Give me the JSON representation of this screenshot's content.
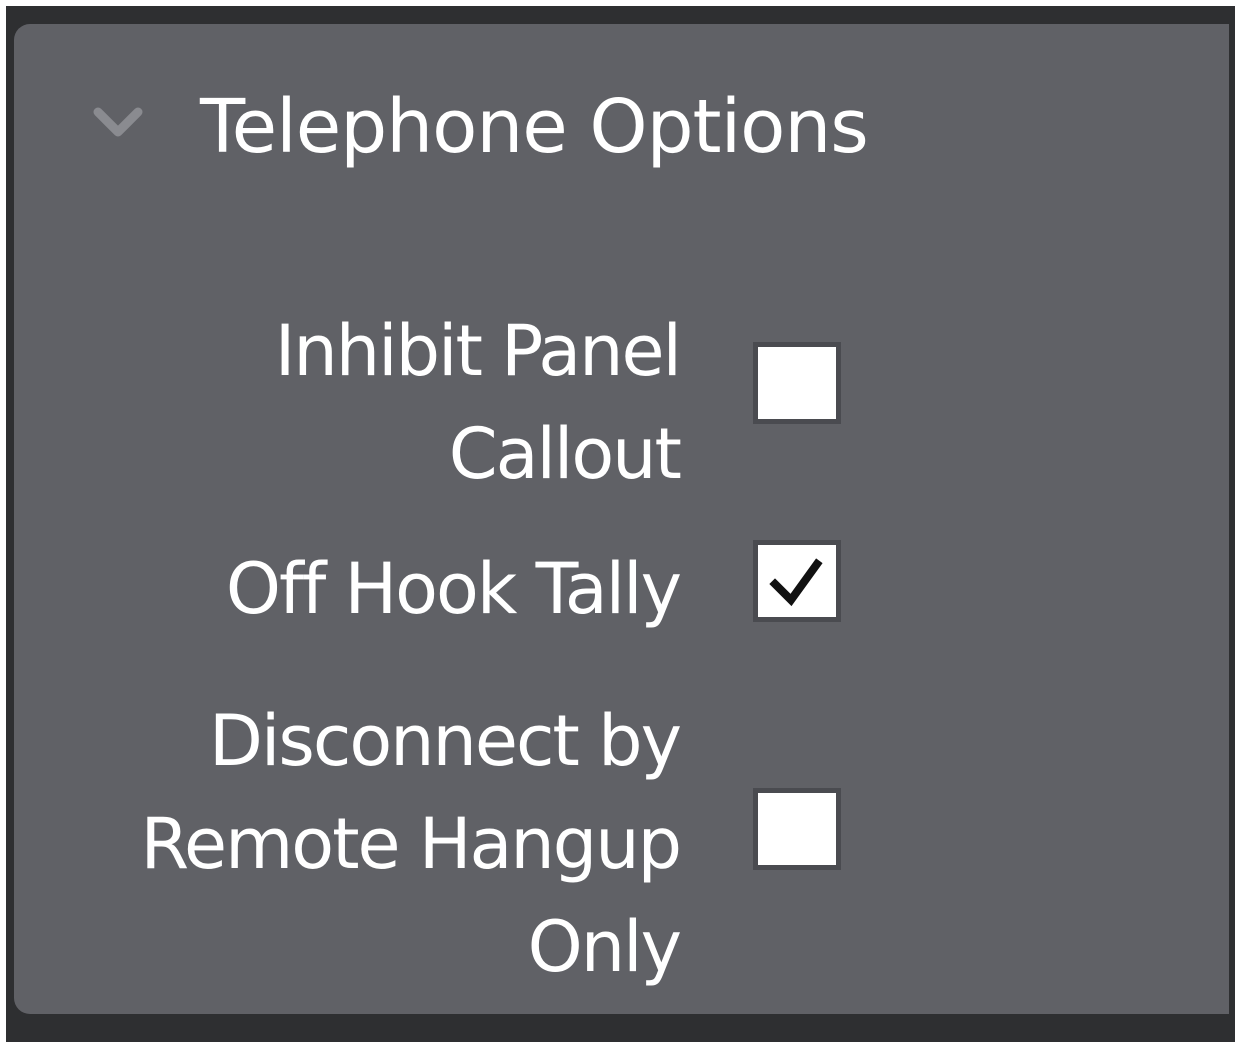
{
  "section": {
    "title": "Telephone Options",
    "expanded": true,
    "chevron_icon": "chevron-down-icon"
  },
  "options": [
    {
      "label_lines": [
        "Inhibit Panel",
        "Callout"
      ],
      "checked": false
    },
    {
      "label_lines": [
        "Off Hook Tally"
      ],
      "checked": true
    },
    {
      "label_lines": [
        "Disconnect by",
        "Remote Hangup",
        "Only"
      ],
      "checked": false
    }
  ],
  "colors": {
    "frame": "#2e2f31",
    "panel": "#606166",
    "text": "#ffffff",
    "checkbox_fill": "#ffffff",
    "checkmark": "#111111"
  }
}
